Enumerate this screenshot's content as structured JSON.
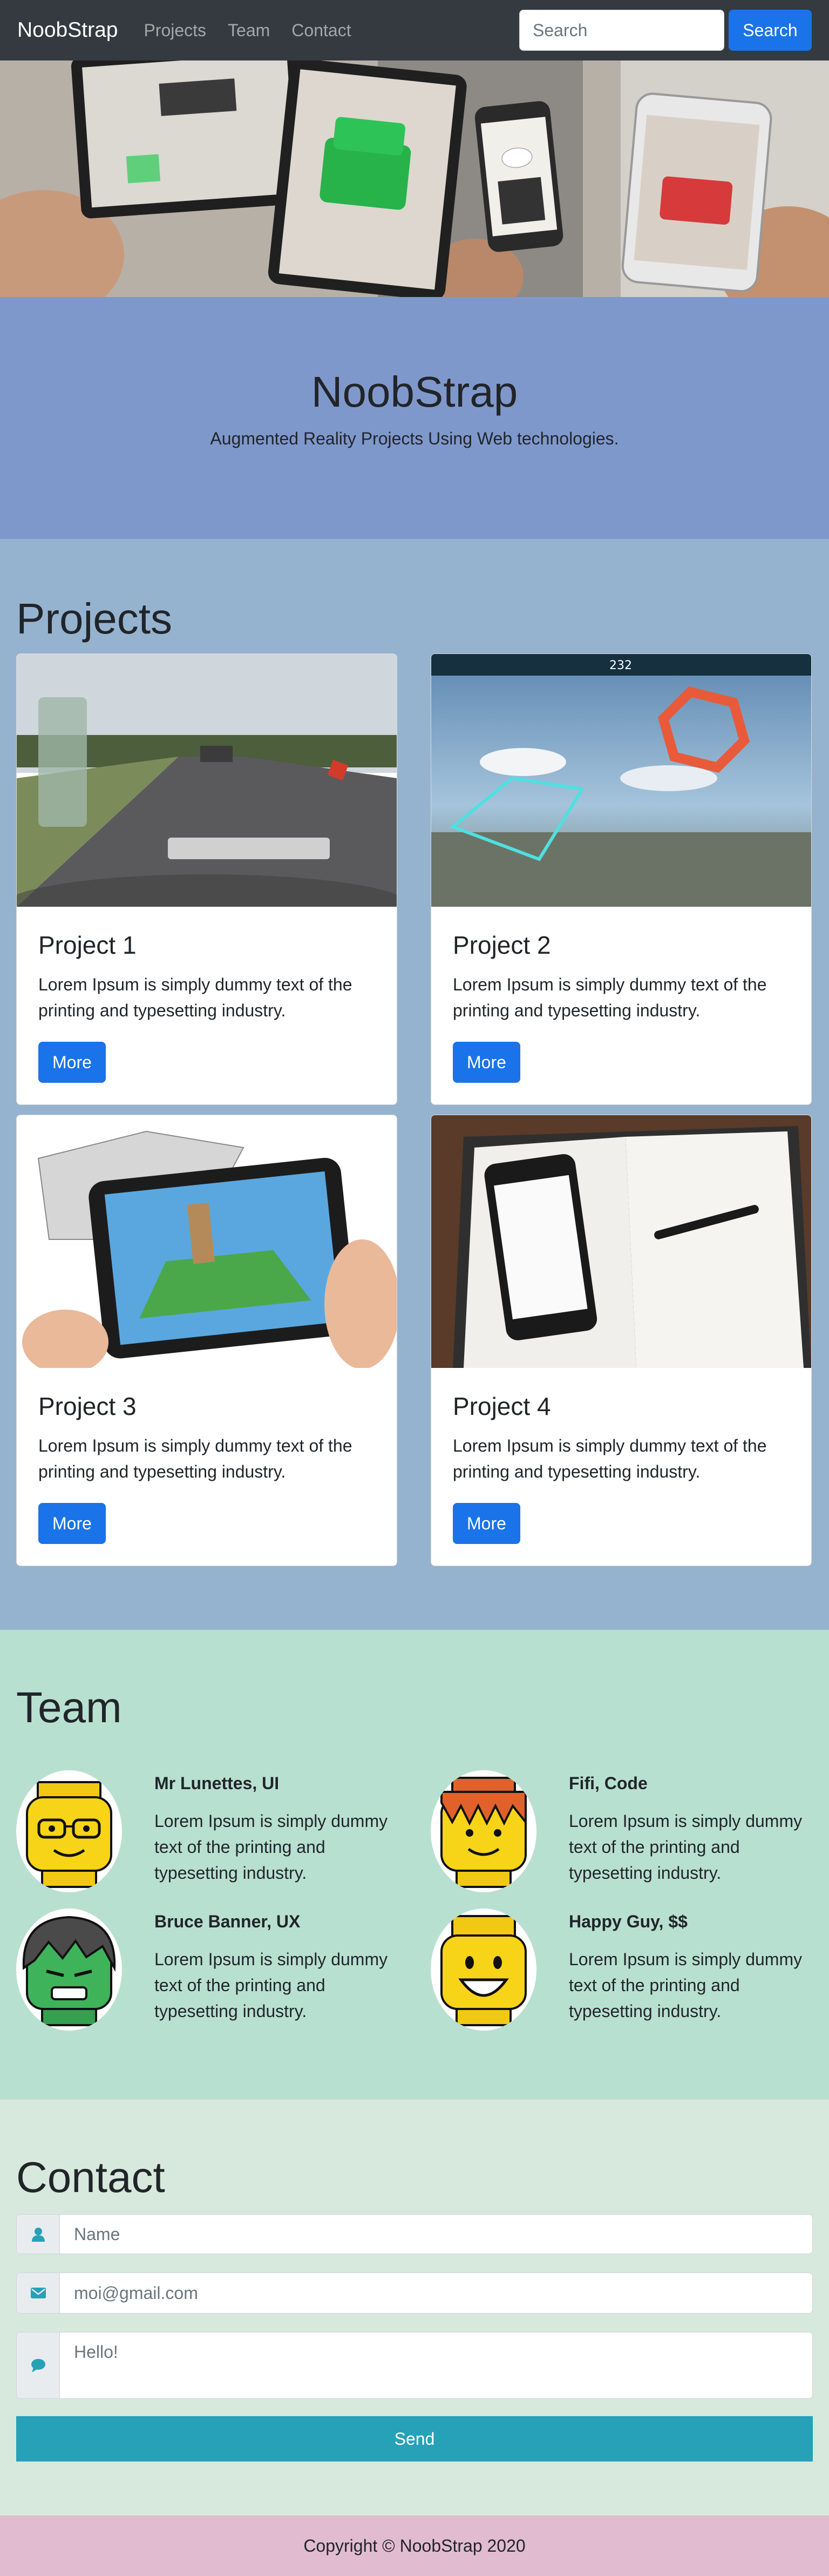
{
  "navbar": {
    "brand": "NoobStrap",
    "links": [
      "Projects",
      "Team",
      "Contact"
    ],
    "search_placeholder": "Search",
    "search_button": "Search"
  },
  "jumbotron": {
    "title": "NoobStrap",
    "subtitle": "Augmented Reality Projects Using Web technologies."
  },
  "projects": {
    "title": "Projects",
    "items": [
      {
        "title": "Project 1",
        "text": "Lorem Ipsum is simply dummy text of the printing and typesetting industry.",
        "button": "More"
      },
      {
        "title": "Project 2",
        "text": "Lorem Ipsum is simply dummy text of the printing and typesetting industry.",
        "button": "More"
      },
      {
        "title": "Project 3",
        "text": "Lorem Ipsum is simply dummy text of the printing and typesetting industry.",
        "button": "More"
      },
      {
        "title": "Project 4",
        "text": "Lorem Ipsum is simply dummy text of the printing and typesetting industry.",
        "button": "More"
      }
    ]
  },
  "team": {
    "title": "Team",
    "members": [
      {
        "name": "Mr Lunettes, UI",
        "bio": "Lorem Ipsum is simply dummy text of the printing and typesetting industry."
      },
      {
        "name": "Fifi, Code",
        "bio": "Lorem Ipsum is simply dummy text of the printing and typesetting industry."
      },
      {
        "name": "Bruce Banner, UX",
        "bio": "Lorem Ipsum is simply dummy text of the printing and typesetting industry."
      },
      {
        "name": "Happy Guy, $$",
        "bio": "Lorem Ipsum is simply dummy text of the printing and typesetting industry."
      }
    ]
  },
  "contact": {
    "title": "Contact",
    "name_placeholder": "Name",
    "email_placeholder": "moi@gmail.com",
    "message_placeholder": "Hello!",
    "send_button": "Send",
    "icons": [
      "user-icon",
      "envelope-icon",
      "comment-icon"
    ]
  },
  "footer": {
    "text": "Copyright © NoobStrap 2020"
  },
  "colors": {
    "navbar": "#343a40",
    "primary": "#1a73e8",
    "jumbotron": "#7f98cc",
    "projects_bg": "#95b3cf",
    "team_bg": "#b8e0d1",
    "contact_bg": "#d7e9dd",
    "send": "#26a1b8",
    "footer": "#e1bcd0"
  }
}
